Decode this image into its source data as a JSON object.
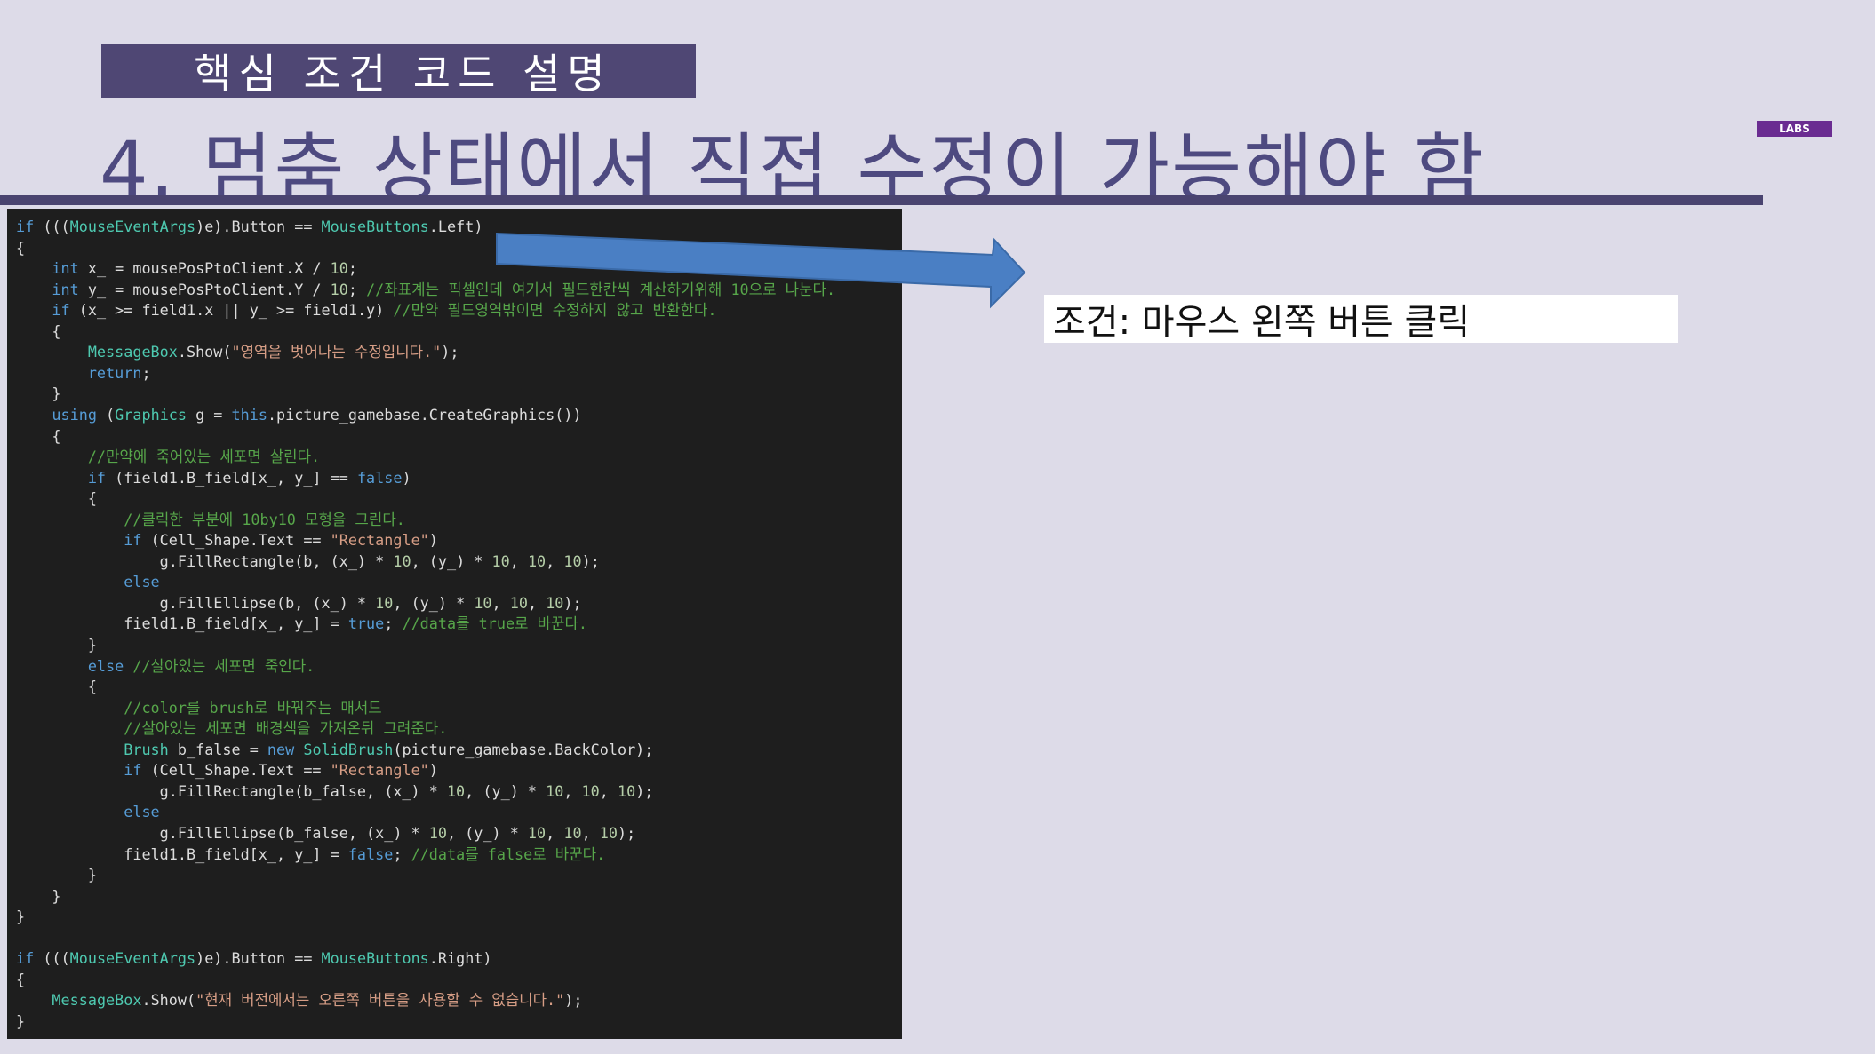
{
  "header": {
    "section_tag": "핵심 조건 코드 설명",
    "title": "4. 멈춤 상태에서 직접 수정이 가능해야 함",
    "badge": "LABS"
  },
  "callout": {
    "condition": "조건: 마우스 왼쪽 버튼 클릭"
  },
  "colors": {
    "background": "#dddbe8",
    "header_band": "#4f4774",
    "title_text": "#4e4a80",
    "code_background": "#1e1e1e",
    "arrow_fill": "#4a7fc4",
    "badge": "#6a2c91"
  },
  "code": {
    "lines": [
      [
        [
          "kw",
          "if"
        ],
        [
          "p",
          " ((("
        ],
        [
          "type",
          "MouseEventArgs"
        ],
        [
          "p",
          ")e).Button == "
        ],
        [
          "type",
          "MouseButtons"
        ],
        [
          "p",
          ".Left)"
        ]
      ],
      [
        [
          "p",
          "{"
        ]
      ],
      [
        [
          "p",
          "    "
        ],
        [
          "kw",
          "int"
        ],
        [
          "p",
          " x_ = mousePosPtoClient.X / "
        ],
        [
          "num",
          "10"
        ],
        [
          "p",
          ";"
        ]
      ],
      [
        [
          "p",
          "    "
        ],
        [
          "kw",
          "int"
        ],
        [
          "p",
          " y_ = mousePosPtoClient.Y / "
        ],
        [
          "num",
          "10"
        ],
        [
          "p",
          "; "
        ],
        [
          "cmt",
          "//좌표계는 픽셀인데 여기서 필드한칸씩 계산하기위해 10으로 나눈다."
        ]
      ],
      [
        [
          "p",
          "    "
        ],
        [
          "kw",
          "if"
        ],
        [
          "p",
          " (x_ >= field1.x || y_ >= field1.y) "
        ],
        [
          "cmt",
          "//만약 필드영역밖이면 수정하지 않고 반환한다."
        ]
      ],
      [
        [
          "p",
          "    {"
        ]
      ],
      [
        [
          "p",
          "        "
        ],
        [
          "type",
          "MessageBox"
        ],
        [
          "p",
          ".Show("
        ],
        [
          "str",
          "\"영역을 벗어나는 수정입니다.\""
        ],
        [
          "p",
          ");"
        ]
      ],
      [
        [
          "p",
          "        "
        ],
        [
          "kw",
          "return"
        ],
        [
          "p",
          ";"
        ]
      ],
      [
        [
          "p",
          "    }"
        ]
      ],
      [
        [
          "p",
          "    "
        ],
        [
          "kw",
          "using"
        ],
        [
          "p",
          " ("
        ],
        [
          "type",
          "Graphics"
        ],
        [
          "p",
          " g = "
        ],
        [
          "kw",
          "this"
        ],
        [
          "p",
          ".picture_gamebase.CreateGraphics())"
        ]
      ],
      [
        [
          "p",
          "    {"
        ]
      ],
      [
        [
          "p",
          "        "
        ],
        [
          "cmt",
          "//만약에 죽어있는 세포면 살린다."
        ]
      ],
      [
        [
          "p",
          "        "
        ],
        [
          "kw",
          "if"
        ],
        [
          "p",
          " (field1.B_field[x_, y_] == "
        ],
        [
          "kw",
          "false"
        ],
        [
          "p",
          ")"
        ]
      ],
      [
        [
          "p",
          "        {"
        ]
      ],
      [
        [
          "p",
          "            "
        ],
        [
          "cmt",
          "//클릭한 부분에 10by10 모형을 그린다."
        ]
      ],
      [
        [
          "p",
          "            "
        ],
        [
          "kw",
          "if"
        ],
        [
          "p",
          " (Cell_Shape.Text == "
        ],
        [
          "str",
          "\"Rectangle\""
        ],
        [
          "p",
          ")"
        ]
      ],
      [
        [
          "p",
          "                g.FillRectangle(b, (x_) * "
        ],
        [
          "num",
          "10"
        ],
        [
          "p",
          ", (y_) * "
        ],
        [
          "num",
          "10"
        ],
        [
          "p",
          ", "
        ],
        [
          "num",
          "10"
        ],
        [
          "p",
          ", "
        ],
        [
          "num",
          "10"
        ],
        [
          "p",
          ");"
        ]
      ],
      [
        [
          "p",
          "            "
        ],
        [
          "kw",
          "else"
        ]
      ],
      [
        [
          "p",
          "                g.FillEllipse(b, (x_) * "
        ],
        [
          "num",
          "10"
        ],
        [
          "p",
          ", (y_) * "
        ],
        [
          "num",
          "10"
        ],
        [
          "p",
          ", "
        ],
        [
          "num",
          "10"
        ],
        [
          "p",
          ", "
        ],
        [
          "num",
          "10"
        ],
        [
          "p",
          ");"
        ]
      ],
      [
        [
          "p",
          "            field1.B_field[x_, y_] = "
        ],
        [
          "kw",
          "true"
        ],
        [
          "p",
          "; "
        ],
        [
          "cmt",
          "//data를 true로 바꾼다."
        ]
      ],
      [
        [
          "p",
          "        }"
        ]
      ],
      [
        [
          "p",
          "        "
        ],
        [
          "kw",
          "else"
        ],
        [
          "p",
          " "
        ],
        [
          "cmt",
          "//살아있는 세포면 죽인다."
        ]
      ],
      [
        [
          "p",
          "        {"
        ]
      ],
      [
        [
          "p",
          "            "
        ],
        [
          "cmt",
          "//color를 brush로 바꿔주는 매서드"
        ]
      ],
      [
        [
          "p",
          "            "
        ],
        [
          "cmt",
          "//살아있는 세포면 배경색을 가져온뒤 그려준다."
        ]
      ],
      [
        [
          "p",
          "            "
        ],
        [
          "type",
          "Brush"
        ],
        [
          "p",
          " b_false = "
        ],
        [
          "kw",
          "new"
        ],
        [
          "p",
          " "
        ],
        [
          "type",
          "SolidBrush"
        ],
        [
          "p",
          "(picture_gamebase.BackColor);"
        ]
      ],
      [
        [
          "p",
          "            "
        ],
        [
          "kw",
          "if"
        ],
        [
          "p",
          " (Cell_Shape.Text == "
        ],
        [
          "str",
          "\"Rectangle\""
        ],
        [
          "p",
          ")"
        ]
      ],
      [
        [
          "p",
          "                g.FillRectangle(b_false, (x_) * "
        ],
        [
          "num",
          "10"
        ],
        [
          "p",
          ", (y_) * "
        ],
        [
          "num",
          "10"
        ],
        [
          "p",
          ", "
        ],
        [
          "num",
          "10"
        ],
        [
          "p",
          ", "
        ],
        [
          "num",
          "10"
        ],
        [
          "p",
          ");"
        ]
      ],
      [
        [
          "p",
          "            "
        ],
        [
          "kw",
          "else"
        ]
      ],
      [
        [
          "p",
          "                g.FillEllipse(b_false, (x_) * "
        ],
        [
          "num",
          "10"
        ],
        [
          "p",
          ", (y_) * "
        ],
        [
          "num",
          "10"
        ],
        [
          "p",
          ", "
        ],
        [
          "num",
          "10"
        ],
        [
          "p",
          ", "
        ],
        [
          "num",
          "10"
        ],
        [
          "p",
          ");"
        ]
      ],
      [
        [
          "p",
          "            field1.B_field[x_, y_] = "
        ],
        [
          "kw",
          "false"
        ],
        [
          "p",
          "; "
        ],
        [
          "cmt",
          "//data를 false로 바꾼다."
        ]
      ],
      [
        [
          "p",
          "        }"
        ]
      ],
      [
        [
          "p",
          "    }"
        ]
      ],
      [
        [
          "p",
          "}"
        ]
      ],
      [
        [
          "p",
          ""
        ]
      ],
      [
        [
          "kw",
          "if"
        ],
        [
          "p",
          " ((("
        ],
        [
          "type",
          "MouseEventArgs"
        ],
        [
          "p",
          ")e).Button == "
        ],
        [
          "type",
          "MouseButtons"
        ],
        [
          "p",
          ".Right)"
        ]
      ],
      [
        [
          "p",
          "{"
        ]
      ],
      [
        [
          "p",
          "    "
        ],
        [
          "type",
          "MessageBox"
        ],
        [
          "p",
          ".Show("
        ],
        [
          "str",
          "\"현재 버전에서는 오른쪽 버튼을 사용할 수 없습니다.\""
        ],
        [
          "p",
          ");"
        ]
      ],
      [
        [
          "p",
          "}"
        ]
      ]
    ]
  }
}
